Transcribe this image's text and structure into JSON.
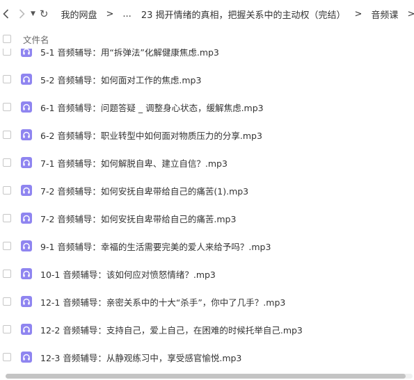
{
  "toolbar": {
    "back_icon": "chevron-left-icon",
    "forward_icon": "chevron-right-icon",
    "dropdown_icon": "triangle-down-icon",
    "refresh_icon": "refresh-icon"
  },
  "breadcrumb": {
    "items": [
      "我的网盘",
      "...",
      "23 揭开情绪的真相，把握关系中的主动权（完结）",
      "音频课"
    ],
    "separator": ">"
  },
  "list_header": {
    "name_label": "文件名"
  },
  "files": [
    "5-1 音频辅导：用“拆弹法”化解健康焦虑.mp3",
    "5-2 音频辅导：如何面对工作的焦虑.mp3",
    "6-1 音频辅导：问题答疑 _ 调整身心状态，缓解焦虑.mp3",
    "6-2 音频辅导：职业转型中如何面对物质压力的分享.mp3",
    "7-1 音频辅导：如何解脱自卑、建立自信？.mp3",
    "7-2 音频辅导：如何安抚自卑带给自己的痛苦(1).mp3",
    "7-2 音频辅导：如何安抚自卑带给自己的痛苦.mp3",
    "9-1 音频辅导：幸福的生活需要完美的爱人来给予吗？.mp3",
    "10-1 音频辅导：该如何应对愤怒情绪？.mp3",
    "12-1 音频辅导：亲密关系中的十大“杀手”，你中了几手？.mp3",
    "12-2 音频辅导：支持自己，爱上自己，在困难的时候托举自己.mp3",
    "12-3 音频辅导：从静观练习中，享受感官愉悦.mp3"
  ],
  "file_icon": "audio-headphones-icon",
  "colors": {
    "audio_icon_bg": "#8f85f0",
    "checkbox_border": "#c6c6c6"
  }
}
